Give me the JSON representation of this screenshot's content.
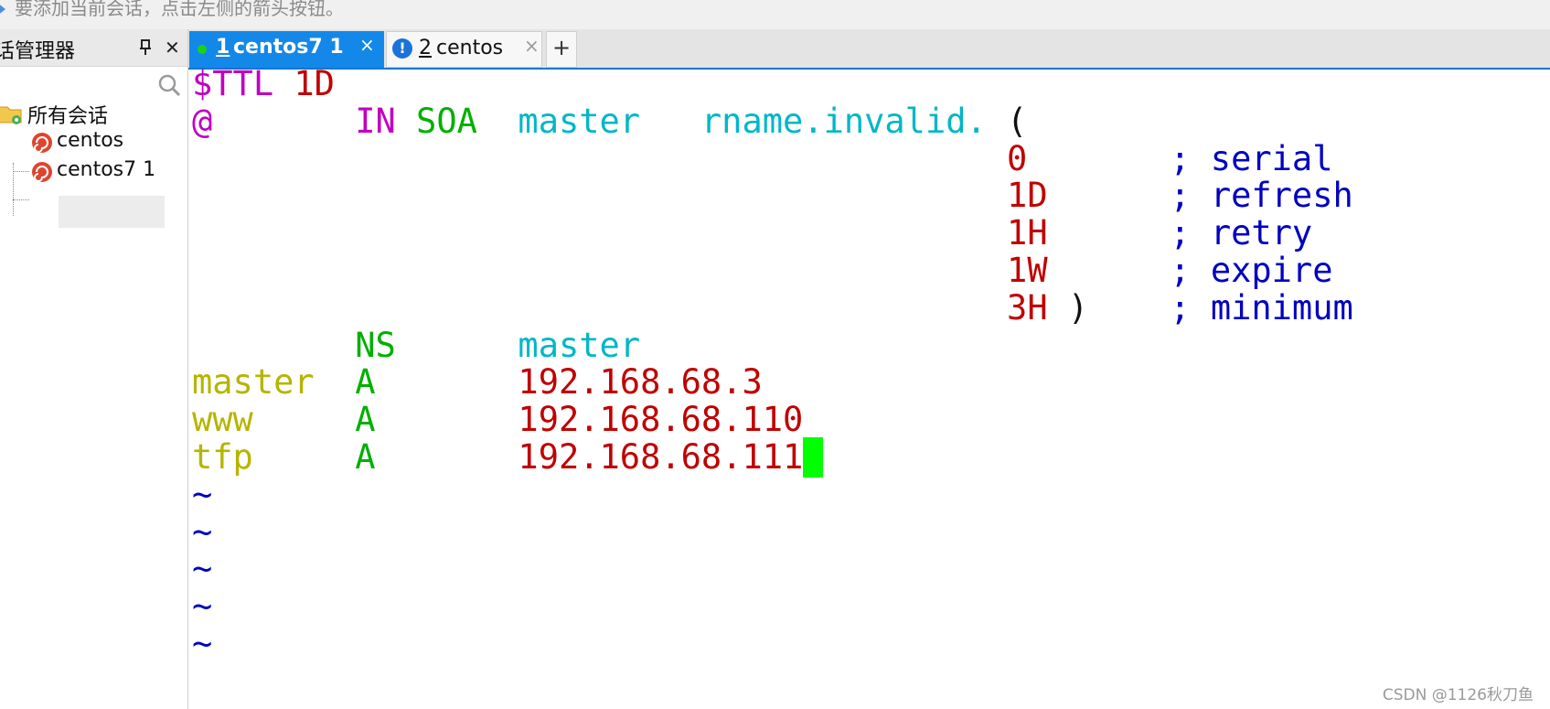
{
  "hint_text": "要添加当前会话，点击左侧的箭头按钮。",
  "side_panel": {
    "title": "话管理器",
    "close_glyph": "✕",
    "tree": {
      "root_label": "所有会话",
      "children": [
        {
          "label": "centos"
        },
        {
          "label": "centos7 1"
        }
      ]
    }
  },
  "tabs": [
    {
      "number": "1",
      "label": " centos7 1",
      "status": "connected",
      "active": true,
      "close_glyph": "×"
    },
    {
      "number": "2",
      "label": " centos",
      "status": "info",
      "active": false,
      "close_glyph": "×"
    }
  ],
  "new_tab_glyph": "+",
  "info_glyph": "!",
  "terminal": {
    "lines": [
      [
        {
          "t": "$TTL ",
          "c": "magenta"
        },
        {
          "t": "1D",
          "c": "red"
        }
      ],
      [
        {
          "t": "@",
          "c": "magenta"
        },
        {
          "t": "       ",
          "c": "black"
        },
        {
          "t": "IN ",
          "c": "magenta"
        },
        {
          "t": "SOA",
          "c": "green"
        },
        {
          "t": "  master   rname.invalid.",
          "c": "cyan"
        },
        {
          "t": " (",
          "c": "black"
        }
      ],
      [
        {
          "t": "                                        ",
          "c": "black"
        },
        {
          "t": "0",
          "c": "red"
        },
        {
          "t": "       ; serial",
          "c": "blue"
        }
      ],
      [
        {
          "t": "                                        ",
          "c": "black"
        },
        {
          "t": "1D",
          "c": "red"
        },
        {
          "t": "      ; refresh",
          "c": "blue"
        }
      ],
      [
        {
          "t": "                                        ",
          "c": "black"
        },
        {
          "t": "1H",
          "c": "red"
        },
        {
          "t": "      ; retry",
          "c": "blue"
        }
      ],
      [
        {
          "t": "                                        ",
          "c": "black"
        },
        {
          "t": "1W",
          "c": "red"
        },
        {
          "t": "      ; expire",
          "c": "blue"
        }
      ],
      [
        {
          "t": "                                        ",
          "c": "black"
        },
        {
          "t": "3H",
          "c": "red"
        },
        {
          "t": " )",
          "c": "black"
        },
        {
          "t": "    ; minimum",
          "c": "blue"
        }
      ],
      [
        {
          "t": "        ",
          "c": "black"
        },
        {
          "t": "NS",
          "c": "green"
        },
        {
          "t": "      master",
          "c": "cyan"
        }
      ],
      [
        {
          "t": "master  ",
          "c": "olive"
        },
        {
          "t": "A",
          "c": "green"
        },
        {
          "t": "       192.168.68.3",
          "c": "red"
        }
      ],
      [
        {
          "t": "www     ",
          "c": "olive"
        },
        {
          "t": "A",
          "c": "green"
        },
        {
          "t": "       192.168.68.110",
          "c": "red"
        }
      ],
      [
        {
          "t": "tfp     ",
          "c": "olive"
        },
        {
          "t": "A",
          "c": "green"
        },
        {
          "t": "       192.168.68.111",
          "c": "red"
        }
      ],
      [
        {
          "t": "~",
          "c": "blue"
        }
      ],
      [
        {
          "t": "~",
          "c": "blue"
        }
      ],
      [
        {
          "t": "~",
          "c": "blue"
        }
      ],
      [
        {
          "t": "~",
          "c": "blue"
        }
      ],
      [
        {
          "t": "~",
          "c": "blue"
        }
      ]
    ],
    "cursor_line": 10,
    "cursor_color": "#00ff00"
  },
  "watermark": "CSDN @1126秋刀鱼"
}
